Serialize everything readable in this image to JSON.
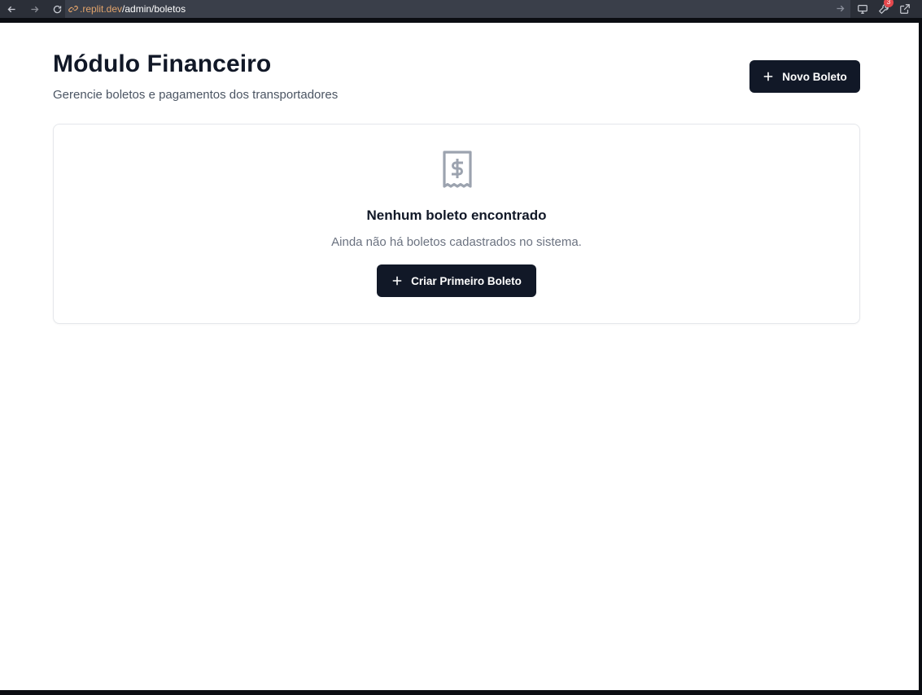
{
  "browser": {
    "url_host": ".replit.dev",
    "url_path": "/admin/boletos",
    "notification_count": "3"
  },
  "header": {
    "title": "Módulo Financeiro",
    "subtitle": "Gerencie boletos e pagamentos dos transportadores",
    "new_button_label": "Novo Boleto"
  },
  "empty_state": {
    "icon": "receipt-dollar-icon",
    "title": "Nenhum boleto encontrado",
    "description": "Ainda não há boletos cadastrados no sistema.",
    "button_label": "Criar Primeiro Boleto"
  },
  "colors": {
    "primary": "#111827",
    "muted_text": "#6b7280",
    "icon_gray": "#9ca3af",
    "url_host": "#e1a36b"
  }
}
